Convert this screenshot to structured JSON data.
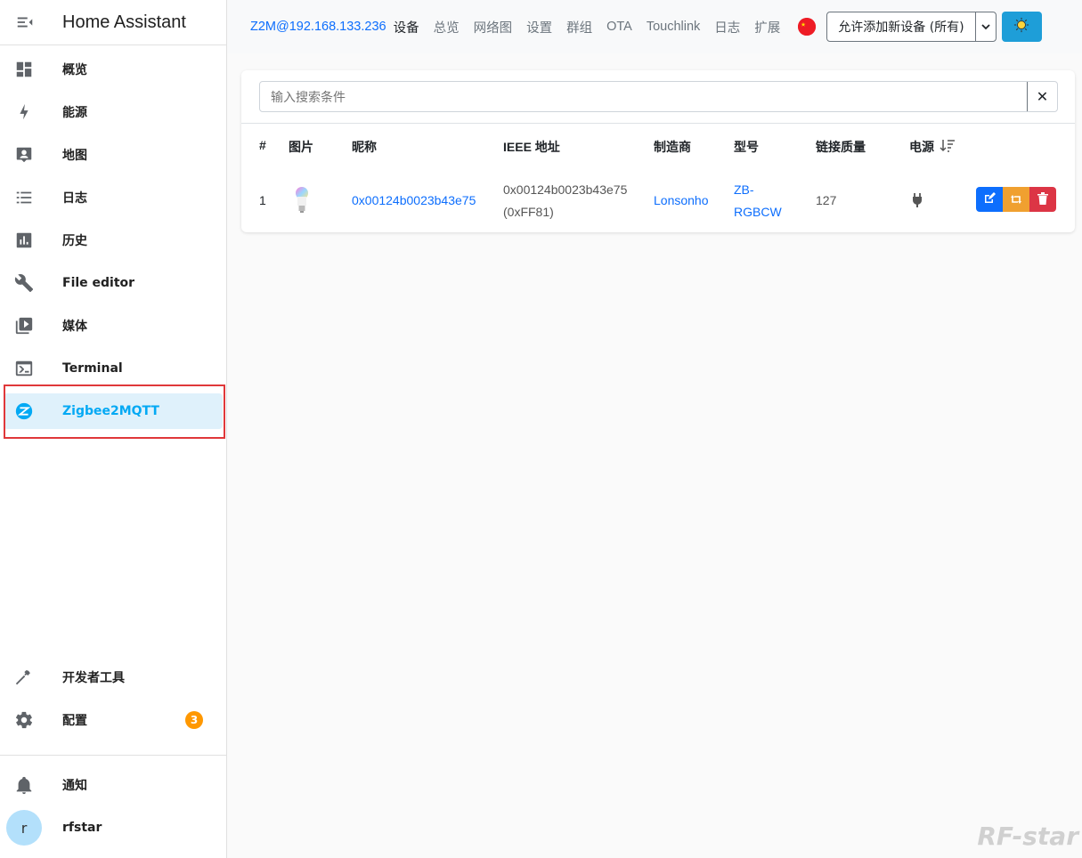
{
  "sidebar": {
    "title": "Home Assistant",
    "items": [
      {
        "label": "概览"
      },
      {
        "label": "能源"
      },
      {
        "label": "地图"
      },
      {
        "label": "日志"
      },
      {
        "label": "历史"
      },
      {
        "label": "File editor"
      },
      {
        "label": "媒体"
      },
      {
        "label": "Terminal"
      },
      {
        "label": "Zigbee2MQTT"
      }
    ],
    "bottom": {
      "dev_tools": "开发者工具",
      "config": "配置",
      "config_badge": "3",
      "notifications": "通知",
      "user_initial": "r",
      "user_name": "rfstar"
    }
  },
  "topbar": {
    "brand": "Z2M@192.168.133.236",
    "nav": [
      "设备",
      "总览",
      "网络图",
      "设置",
      "群组",
      "OTA",
      "Touchlink",
      "日志",
      "扩展"
    ],
    "permit_join": "允许添加新设备 (所有)"
  },
  "devices": {
    "search_placeholder": "输入搜索条件",
    "headers": {
      "num": "#",
      "image": "图片",
      "nickname": "昵称",
      "ieee": "IEEE 地址",
      "manufacturer": "制造商",
      "model": "型号",
      "lqi": "链接质量",
      "power": "电源"
    },
    "rows": [
      {
        "num": "1",
        "nickname": "0x00124b0023b43e75",
        "ieee": "0x00124b0023b43e75",
        "ieee_short": "(0xFF81)",
        "manufacturer": "Lonsonho",
        "model_line1": "ZB-",
        "model_line2": "RGBCW",
        "lqi": "127"
      }
    ]
  },
  "watermark": "RF-star"
}
